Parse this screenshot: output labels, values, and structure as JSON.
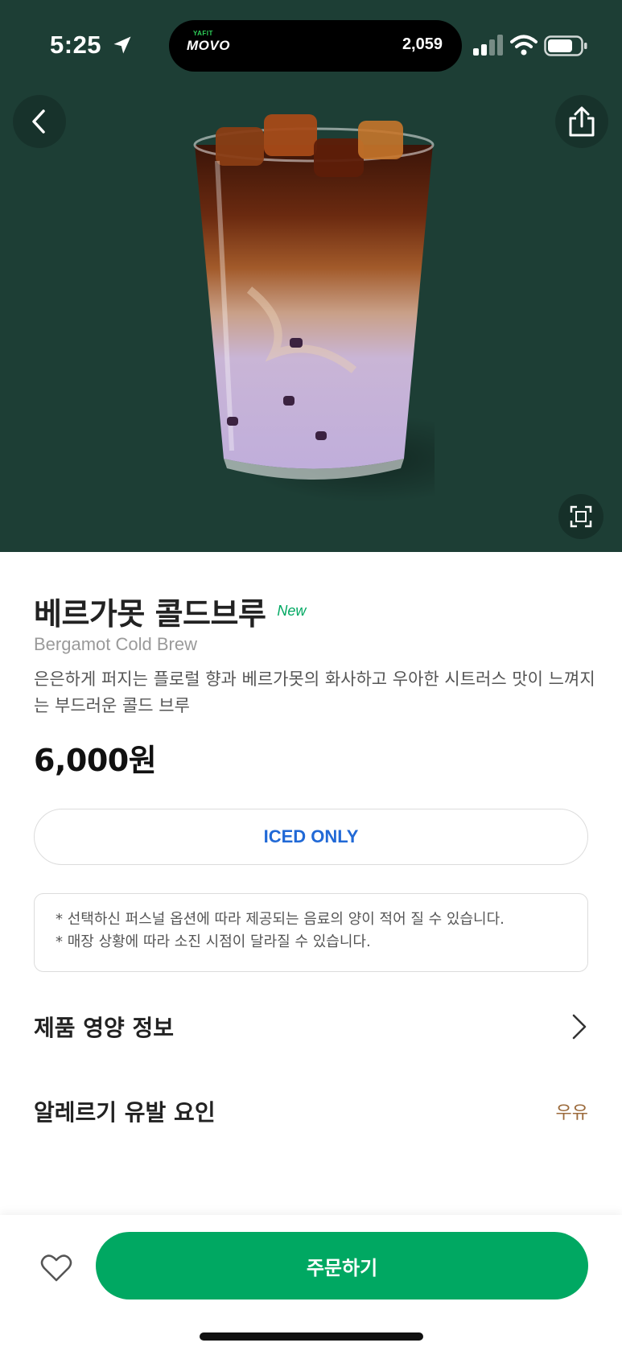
{
  "status_bar": {
    "time": "5:25",
    "island_brand_small": "YAFIT",
    "island_brand": "MOVO",
    "island_count": "2,059"
  },
  "hero": {
    "background_color": "#1d3e35",
    "icons": [
      "back-icon",
      "share-icon",
      "expand-icon"
    ]
  },
  "product": {
    "name_ko": "베르가못 콜드브루",
    "badge": "New",
    "name_en": "Bergamot Cold Brew",
    "description": "은은하게 퍼지는 플로럴 향과 베르가못의 화사하고 우아한 시트러스 맛이 느껴지는 부드러운 콜드 브루",
    "price": "6,000원",
    "temperature_option": "ICED ONLY"
  },
  "notice": {
    "lines": [
      "* 선택하신 퍼스널 옵션에 따라 제공되는 음료의 양이 적어 질 수 있습니다.",
      "* 매장 상황에 따라 소진 시점이 달라질 수 있습니다."
    ]
  },
  "info": {
    "nutrition_label": "제품 영양 정보",
    "allergy_label": "알레르기 유발 요인",
    "allergy_value": "우유"
  },
  "bottom": {
    "order_label": "주문하기"
  },
  "colors": {
    "accent_green": "#00a862",
    "iced_blue": "#2169d6",
    "allergy_brown": "#9b6a3b"
  }
}
